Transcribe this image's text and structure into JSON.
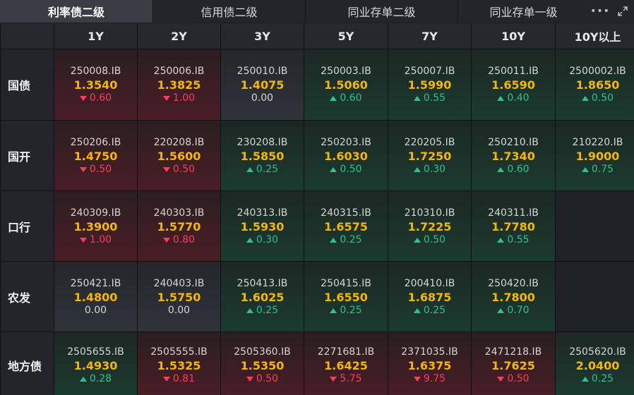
{
  "tabs": [
    {
      "label": "利率债二级",
      "active": true
    },
    {
      "label": "信用债二级",
      "active": false
    },
    {
      "label": "同业存单二级",
      "active": false
    },
    {
      "label": "同业存单一级",
      "active": false
    }
  ],
  "toolbar": {
    "more_label": "•••"
  },
  "colors": {
    "up": "#2bc48a",
    "down": "#ff3d57",
    "rate": "#f5b800"
  },
  "columns": [
    "1Y",
    "2Y",
    "3Y",
    "5Y",
    "7Y",
    "10Y",
    "10Y以上"
  ],
  "rows": [
    {
      "label": "国债",
      "cells": [
        {
          "code": "250008.IB",
          "rate": "1.3540",
          "change": "0.60",
          "dir": "down"
        },
        {
          "code": "250006.IB",
          "rate": "1.3825",
          "change": "1.00",
          "dir": "down"
        },
        {
          "code": "250010.IB",
          "rate": "1.4075",
          "change": "0.00",
          "dir": "flat"
        },
        {
          "code": "250003.IB",
          "rate": "1.5060",
          "change": "0.60",
          "dir": "up"
        },
        {
          "code": "250007.IB",
          "rate": "1.5990",
          "change": "0.55",
          "dir": "up"
        },
        {
          "code": "250011.IB",
          "rate": "1.6590",
          "change": "0.40",
          "dir": "up"
        },
        {
          "code": "2500002.IB",
          "rate": "1.8650",
          "change": "0.50",
          "dir": "up"
        }
      ]
    },
    {
      "label": "国开",
      "cells": [
        {
          "code": "250206.IB",
          "rate": "1.4750",
          "change": "0.50",
          "dir": "down"
        },
        {
          "code": "220208.IB",
          "rate": "1.5600",
          "change": "0.50",
          "dir": "down"
        },
        {
          "code": "230208.IB",
          "rate": "1.5850",
          "change": "0.25",
          "dir": "up"
        },
        {
          "code": "250203.IB",
          "rate": "1.6030",
          "change": "0.50",
          "dir": "up"
        },
        {
          "code": "220205.IB",
          "rate": "1.7250",
          "change": "0.30",
          "dir": "up"
        },
        {
          "code": "250210.IB",
          "rate": "1.7340",
          "change": "0.60",
          "dir": "up"
        },
        {
          "code": "210220.IB",
          "rate": "1.9000",
          "change": "0.75",
          "dir": "up"
        }
      ]
    },
    {
      "label": "口行",
      "cells": [
        {
          "code": "240309.IB",
          "rate": "1.3900",
          "change": "1.00",
          "dir": "down"
        },
        {
          "code": "240303.IB",
          "rate": "1.5770",
          "change": "0.80",
          "dir": "down"
        },
        {
          "code": "240313.IB",
          "rate": "1.5930",
          "change": "0.30",
          "dir": "up"
        },
        {
          "code": "240315.IB",
          "rate": "1.6575",
          "change": "0.25",
          "dir": "up"
        },
        {
          "code": "210310.IB",
          "rate": "1.7225",
          "change": "0.50",
          "dir": "up"
        },
        {
          "code": "240311.IB",
          "rate": "1.7780",
          "change": "0.55",
          "dir": "up"
        },
        null
      ]
    },
    {
      "label": "农发",
      "cells": [
        {
          "code": "250421.IB",
          "rate": "1.4800",
          "change": "0.00",
          "dir": "flat"
        },
        {
          "code": "240403.IB",
          "rate": "1.5750",
          "change": "0.00",
          "dir": "flat"
        },
        {
          "code": "250413.IB",
          "rate": "1.6025",
          "change": "0.25",
          "dir": "up"
        },
        {
          "code": "250415.IB",
          "rate": "1.6550",
          "change": "0.25",
          "dir": "up"
        },
        {
          "code": "200410.IB",
          "rate": "1.6875",
          "change": "0.25",
          "dir": "up"
        },
        {
          "code": "250420.IB",
          "rate": "1.7800",
          "change": "0.70",
          "dir": "up"
        },
        null
      ]
    },
    {
      "label": "地方债",
      "cells": [
        {
          "code": "2505655.IB",
          "rate": "1.4930",
          "change": "0.28",
          "dir": "up"
        },
        {
          "code": "2505555.IB",
          "rate": "1.5325",
          "change": "0.81",
          "dir": "down"
        },
        {
          "code": "2505360.IB",
          "rate": "1.5350",
          "change": "0.50",
          "dir": "down"
        },
        {
          "code": "2271681.IB",
          "rate": "1.6425",
          "change": "5.75",
          "dir": "down"
        },
        {
          "code": "2371035.IB",
          "rate": "1.6375",
          "change": "9.75",
          "dir": "down"
        },
        {
          "code": "2471218.IB",
          "rate": "1.7625",
          "change": "0.50",
          "dir": "down"
        },
        {
          "code": "2505620.IB",
          "rate": "2.0400",
          "change": "0.25",
          "dir": "up"
        }
      ]
    }
  ]
}
